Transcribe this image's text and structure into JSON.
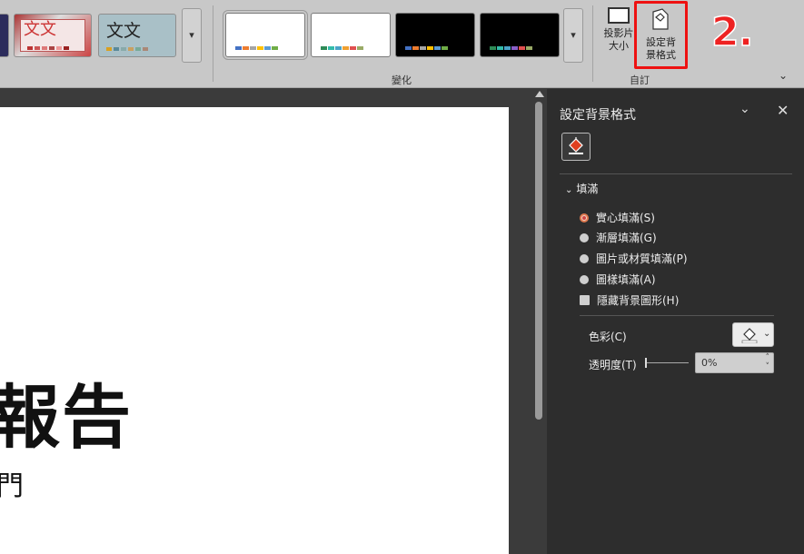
{
  "ribbon": {
    "themes": [
      {
        "text": ""
      },
      {
        "text": "文文"
      },
      {
        "text": "文文"
      }
    ],
    "variants_group_label": "變化",
    "customize_group_label": "自訂",
    "slide_size_label_1": "投影片",
    "slide_size_label_2": "大小",
    "format_bg_label_1": "設定背",
    "format_bg_label_2": "景格式",
    "step_annotation": "2."
  },
  "slide": {
    "title": "報告",
    "subtitle": "門"
  },
  "pane": {
    "title": "設定背景格式",
    "section": "填滿",
    "fill_options": [
      {
        "label": "實心填滿(S)",
        "selected": true
      },
      {
        "label": "漸層填滿(G)",
        "selected": false
      },
      {
        "label": "圖片或材質填滿(P)",
        "selected": false
      },
      {
        "label": "圖樣填滿(A)",
        "selected": false
      }
    ],
    "hide_bg_graphics": "隱藏背景圖形(H)",
    "color_label": "色彩(C)",
    "transparency_label": "透明度(T)",
    "transparency_value": "0%"
  },
  "colors": {
    "accent_red": "#ee2222",
    "pane_bg": "#2d2d2d",
    "ribbon_bg": "#c8c8c8"
  }
}
